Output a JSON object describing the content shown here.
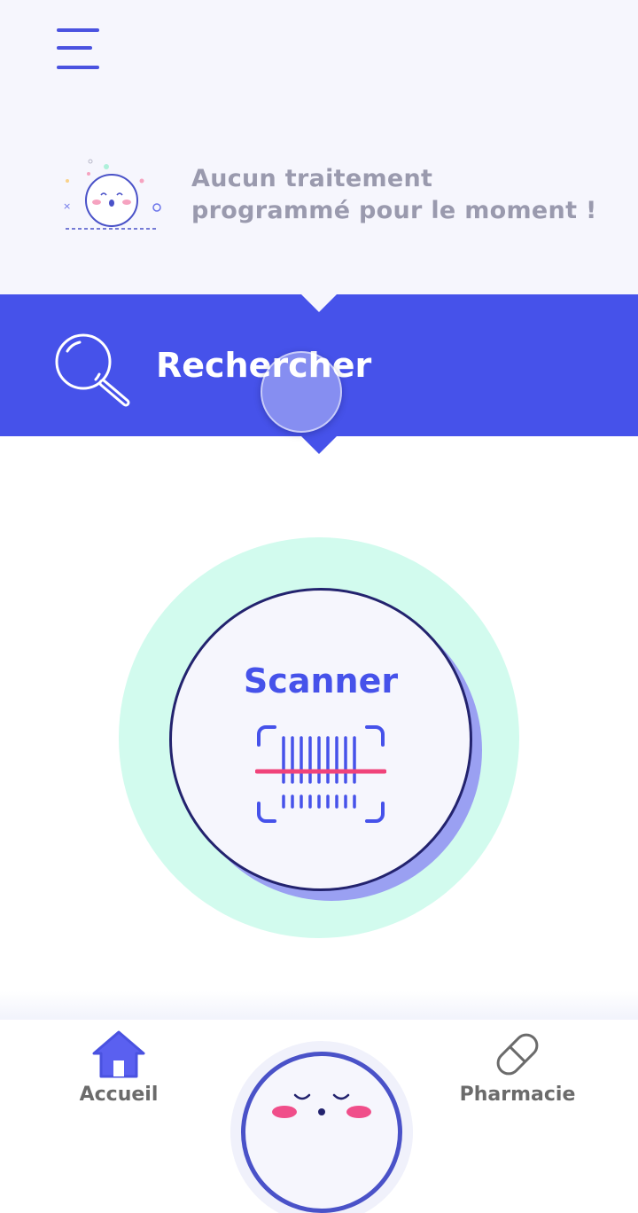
{
  "empty_state": {
    "line1": "Aucun traitement",
    "line2": "programmé pour le moment !"
  },
  "search": {
    "label": "Rechercher",
    "icon": "magnifier-icon"
  },
  "scanner": {
    "label": "Scanner",
    "icon": "barcode-icon"
  },
  "bottom_nav": {
    "home_label": "Accueil",
    "pharmacy_label": "Pharmacie"
  },
  "colors": {
    "accent": "#4652ea",
    "background": "#f6f6fd",
    "ring": "#d2fbee",
    "scan_line": "#f0437a"
  }
}
